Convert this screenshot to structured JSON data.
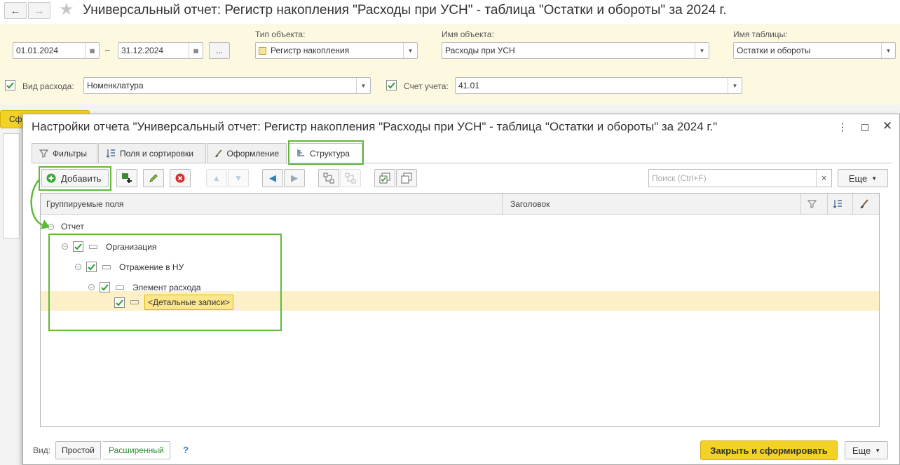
{
  "window": {
    "title": "Универсальный отчет: Регистр накопления \"Расходы при УСН\" - таблица \"Остатки и обороты\" за 2024 г."
  },
  "params": {
    "date_from": "01.01.2024",
    "dash": "–",
    "date_to": "31.12.2024",
    "period_button": "...",
    "object_type_label": "Тип объекта:",
    "object_type_value": "Регистр накопления",
    "object_name_label": "Имя объекта:",
    "object_name_value": "Расходы при УСН",
    "table_name_label": "Имя таблицы:",
    "table_name_value": "Остатки и обороты",
    "expense_type_label": "Вид расхода:",
    "expense_type_value": "Номенклатура",
    "account_label": "Счет учета:",
    "account_value": "41.01"
  },
  "background": {
    "tab_fragment": "Сф"
  },
  "dialog": {
    "title": "Настройки отчета \"Универсальный отчет: Регистр накопления \"Расходы при УСН\" - таблица \"Остатки и обороты\" за 2024 г.\"",
    "tabs": [
      {
        "label": "Фильтры",
        "icon": "filter-icon"
      },
      {
        "label": "Поля и сортировки",
        "icon": "sort-icon"
      },
      {
        "label": "Оформление",
        "icon": "brush-icon"
      },
      {
        "label": "Структура",
        "icon": "structure-icon",
        "active": true
      }
    ],
    "toolbar": {
      "add_label": "Добавить",
      "search_placeholder": "Поиск (Ctrl+F)",
      "clear_search": "×",
      "more_label": "Еще"
    },
    "grid": {
      "col_fields": "Группируемые поля",
      "col_header": "Заголовок",
      "root": "Отчет",
      "rows": [
        {
          "label": "Организация",
          "checked": true
        },
        {
          "label": "Отражение в НУ",
          "checked": true
        },
        {
          "label": "Элемент расхода",
          "checked": true
        },
        {
          "label": "<Детальные записи>",
          "checked": true,
          "selected": true
        }
      ]
    },
    "footer": {
      "view_label": "Вид:",
      "simple": "Простой",
      "extended": "Расширенный",
      "help": "?",
      "close_generate": "Закрыть и сформировать",
      "more_label": "Еще"
    },
    "colors": {
      "highlight_green": "#5fba3a",
      "selected_row": "#fbf0c8",
      "primary_button": "#f3d126"
    }
  }
}
